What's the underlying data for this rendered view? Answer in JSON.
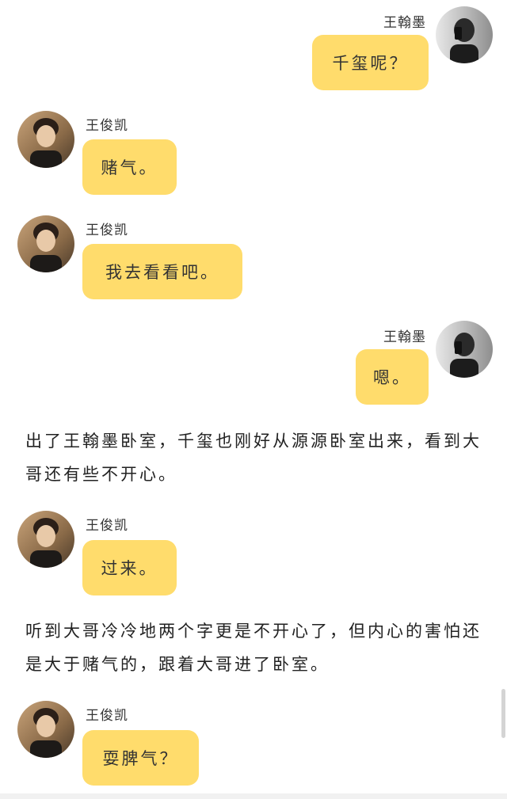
{
  "messages": [
    {
      "speaker": "王翰墨",
      "side": "right",
      "text": "千玺呢？"
    },
    {
      "speaker": "王俊凯",
      "side": "left",
      "text": "赌气。"
    },
    {
      "speaker": "王俊凯",
      "side": "left",
      "text": "我去看看吧。"
    },
    {
      "speaker": "王翰墨",
      "side": "right",
      "text": "嗯。"
    },
    {
      "speaker": "王俊凯",
      "side": "left",
      "text": "过来。"
    },
    {
      "speaker": "王俊凯",
      "side": "left",
      "text": "耍脾气？"
    }
  ],
  "narration": [
    "出了王翰墨卧室，千玺也刚好从源源卧室出来，看到大哥还有些不开心。",
    "听到大哥冷冷地两个字更是不开心了，但内心的害怕还是大于赌气的，跟着大哥进了卧室。"
  ],
  "colors": {
    "bubble": "#ffdc6c",
    "background": "#ffffff"
  }
}
